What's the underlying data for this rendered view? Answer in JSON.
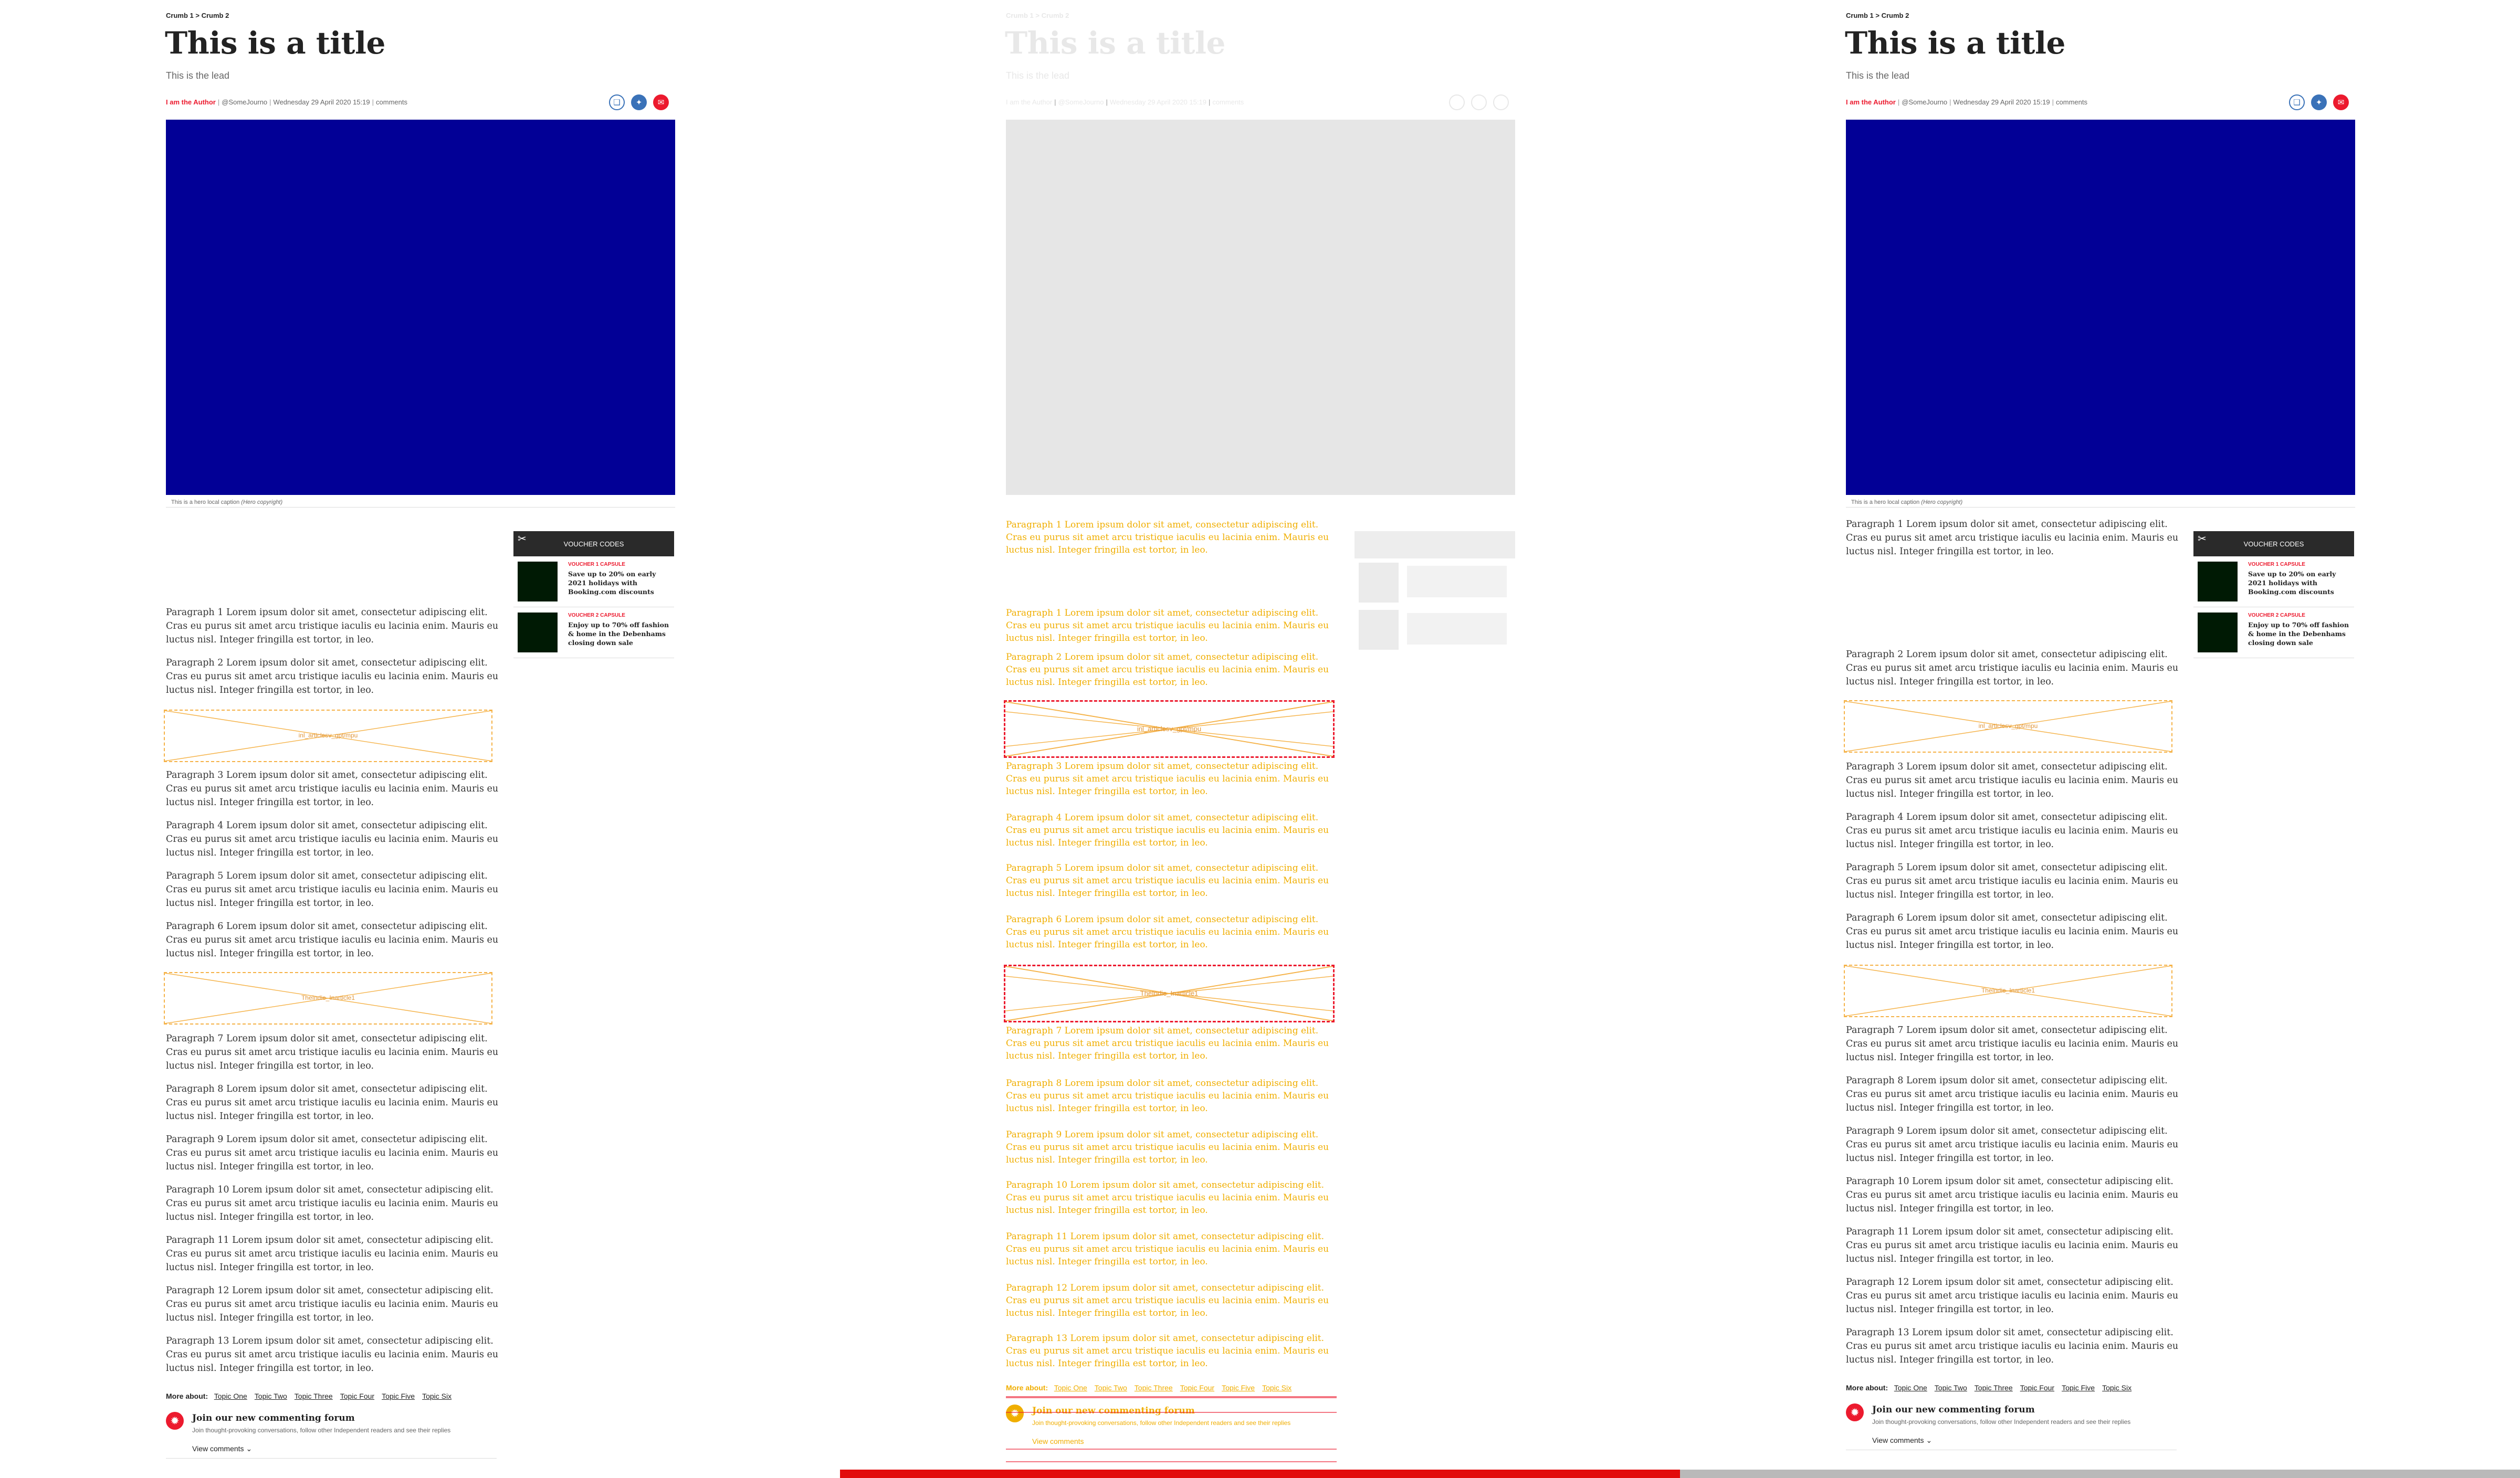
{
  "breadcrumb": {
    "crumb1": "Crumb 1",
    "separator": ">",
    "crumb2": "Crumb 2"
  },
  "article": {
    "title": "This is a title",
    "lead": "This is the lead",
    "author": "I am the Author",
    "handle": "@SomeJourno",
    "date": "Wednesday 29 April 2020 15:19",
    "comments_link": "comments",
    "hero_caption": "This is a hero local caption",
    "hero_copyright": "(Hero copyright)"
  },
  "share": {
    "icons": [
      "bookmark-icon",
      "twitter-icon",
      "email-icon"
    ]
  },
  "voucher": {
    "header": "VOUCHER CODES",
    "items": [
      {
        "brand": "VOUCHER 1 CAPSULE",
        "text": "Save up to 20% on early 2021 holidays with Booking.com discounts"
      },
      {
        "brand": "VOUCHER 2 CAPSULE",
        "text": "Enjoy up to 70% off fashion & home in the Debenhams closing down sale"
      }
    ]
  },
  "paragraphs": [
    "Paragraph 1 Lorem ipsum dolor sit amet, consectetur adipiscing elit. Cras eu purus sit amet arcu tristique iaculis eu lacinia enim. Mauris eu luctus nisl. Integer fringilla est tortor, in leo.",
    "Paragraph 2 Lorem ipsum dolor sit amet, consectetur adipiscing elit. Cras eu purus sit amet arcu tristique iaculis eu lacinia enim. Mauris eu luctus nisl. Integer fringilla est tortor, in leo.",
    "Paragraph 3 Lorem ipsum dolor sit amet, consectetur adipiscing elit. Cras eu purus sit amet arcu tristique iaculis eu lacinia enim. Mauris eu luctus nisl. Integer fringilla est tortor, in leo.",
    "Paragraph 4 Lorem ipsum dolor sit amet, consectetur adipiscing elit. Cras eu purus sit amet arcu tristique iaculis eu lacinia enim. Mauris eu luctus nisl. Integer fringilla est tortor, in leo.",
    "Paragraph 5 Lorem ipsum dolor sit amet, consectetur adipiscing elit. Cras eu purus sit amet arcu tristique iaculis eu lacinia enim. Mauris eu luctus nisl. Integer fringilla est tortor, in leo.",
    "Paragraph 6 Lorem ipsum dolor sit amet, consectetur adipiscing elit. Cras eu purus sit amet arcu tristique iaculis eu lacinia enim. Mauris eu luctus nisl. Integer fringilla est tortor, in leo.",
    "Paragraph 7 Lorem ipsum dolor sit amet, consectetur adipiscing elit. Cras eu purus sit amet arcu tristique iaculis eu lacinia enim. Mauris eu luctus nisl. Integer fringilla est tortor, in leo.",
    "Paragraph 8 Lorem ipsum dolor sit amet, consectetur adipiscing elit. Cras eu purus sit amet arcu tristique iaculis eu lacinia enim. Mauris eu luctus nisl. Integer fringilla est tortor, in leo.",
    "Paragraph 9 Lorem ipsum dolor sit amet, consectetur adipiscing elit. Cras eu purus sit amet arcu tristique iaculis eu lacinia enim. Mauris eu luctus nisl. Integer fringilla est tortor, in leo.",
    "Paragraph 10 Lorem ipsum dolor sit amet, consectetur adipiscing elit. Cras eu purus sit amet arcu tristique iaculis eu lacinia enim. Mauris eu luctus nisl. Integer fringilla est tortor, in leo.",
    "Paragraph 11 Lorem ipsum dolor sit amet, consectetur adipiscing elit. Cras eu purus sit amet arcu tristique iaculis eu lacinia enim. Mauris eu luctus nisl. Integer fringilla est tortor, in leo.",
    "Paragraph 12 Lorem ipsum dolor sit amet, consectetur adipiscing elit. Cras eu purus sit amet arcu tristique iaculis eu lacinia enim. Mauris eu luctus nisl. Integer fringilla est tortor, in leo.",
    "Paragraph 13 Lorem ipsum dolor sit amet, consectetur adipiscing elit. Cras eu purus sit amet arcu tristique iaculis eu lacinia enim. Mauris eu luctus nisl. Integer fringilla est tortor, in leo."
  ],
  "ads": {
    "slot1": "inl_articlesv_gpt/mpu",
    "slot2": "TheIndie_Inarticle1"
  },
  "more_about": {
    "label": "More about:",
    "topics": [
      "Topic One",
      "Topic Two",
      "Topic Three",
      "Topic Four",
      "Topic Five",
      "Topic Six"
    ]
  },
  "comments": {
    "title": "Join our new commenting forum",
    "subtitle": "Join thought-provoking conversations, follow other Independent readers and see their replies",
    "view": "View comments",
    "view_icon": "chevron-down-icon"
  },
  "colors": {
    "accent": "#ec1a2e",
    "hero": "#020096",
    "adslot": "#f5b247",
    "overlay": "#f0ae00"
  }
}
